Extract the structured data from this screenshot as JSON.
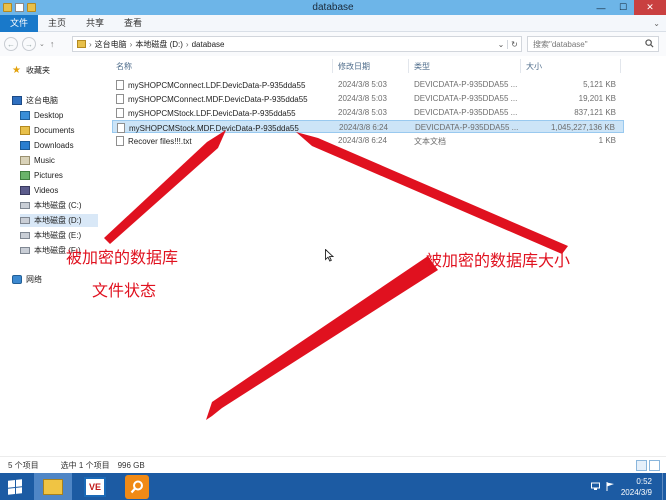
{
  "window": {
    "title": "database",
    "buttons": {
      "minimize": "—",
      "maximize": "☐",
      "close": "✕"
    }
  },
  "ribbon": {
    "tabs": [
      "文件",
      "主页",
      "共享",
      "查看"
    ],
    "expand": "⌄"
  },
  "nav": {
    "back": "←",
    "forward": "→",
    "recent": "⌄",
    "up": "↑",
    "breadcrumb": [
      "这台电脑",
      "本地磁盘 (D:)",
      "database"
    ],
    "breadcrumb_sep": "›",
    "address_dropdown": "⌄",
    "refresh": "↻",
    "search_placeholder": "搜索\"database\"",
    "search_icon": "magnifier"
  },
  "sidebar": {
    "favorites": "收藏夹",
    "this_pc": "这台电脑",
    "items": [
      "Desktop",
      "Documents",
      "Downloads",
      "Music",
      "Pictures",
      "Videos",
      "本地磁盘 (C:)",
      "本地磁盘 (D:)",
      "本地磁盘 (E:)",
      "本地磁盘 (F:)"
    ],
    "network": "网络",
    "selected": "本地磁盘 (D:)"
  },
  "columns": {
    "name": "名称",
    "date": "修改日期",
    "type": "类型",
    "size": "大小"
  },
  "files": [
    {
      "name": "mySHOPCMConnect.LDF.DevicData-P-935dda55",
      "date": "2024/3/8 5:03",
      "type": "DEVICDATA-P-935DDA55 ...",
      "size": "5,121 KB",
      "selected": false
    },
    {
      "name": "mySHOPCMConnect.MDF.DevicData-P-935dda55",
      "date": "2024/3/8 5:03",
      "type": "DEVICDATA-P-935DDA55 ...",
      "size": "19,201 KB",
      "selected": false
    },
    {
      "name": "mySHOPCMStock.LDF.DevicData-P-935dda55",
      "date": "2024/3/8 5:03",
      "type": "DEVICDATA-P-935DDA55 ...",
      "size": "837,121 KB",
      "selected": false
    },
    {
      "name": "mySHOPCMStock.MDF.DevicData-P-935dda55",
      "date": "2024/3/8 6:24",
      "type": "DEVICDATA-P-935DDA55 ...",
      "size": "1,045,227,136 KB",
      "selected": true
    },
    {
      "name": "Recover files!!!.txt",
      "date": "2024/3/8 6:24",
      "type": "文本文档",
      "size": "1 KB",
      "selected": false
    }
  ],
  "annotations": {
    "left_line1": "被加密的数据库",
    "left_line2": "文件状态",
    "right": "被加密的数据库大小",
    "color": "#e0111f"
  },
  "status": {
    "count": "5 个项目",
    "selected": "选中 1 个项目",
    "size": "996 GB"
  },
  "taskbar": {
    "apps": [
      "file-explorer",
      "ve-app",
      "search-tool"
    ],
    "ve_label": "VE",
    "clock_time": "0:52",
    "clock_date": "2024/3/9"
  },
  "accent": "#1979ca"
}
